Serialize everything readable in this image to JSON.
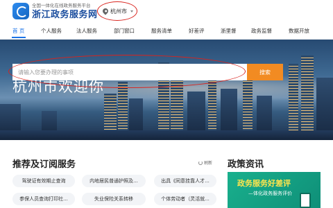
{
  "header": {
    "brand_subtitle": "全国一体化在线政务服务平台",
    "brand_title": "浙江政务服务网",
    "location": "杭州市"
  },
  "nav": {
    "items": [
      "首 页",
      "个人服务",
      "法人服务",
      "部门窗口",
      "服务清单",
      "好差评",
      "浙里督",
      "政务监督",
      "数据开放"
    ],
    "active_index": 0
  },
  "banner": {
    "title": "杭州市欢迎你",
    "search_placeholder": "请输入您要办理的事项",
    "search_button": "搜索"
  },
  "services": {
    "title": "推荐及订阅服务",
    "refresh_label": "刷新",
    "items": [
      "驾驶证有效期止查询",
      "内地居民普通护照及...",
      "出具《同意挂靠人才...",
      "参保人员查询打印社...",
      "失业保险关系转移",
      "个体劳动者（灵活就..."
    ]
  },
  "news": {
    "title": "政策资讯",
    "promo_title": "政务服务好差评",
    "promo_subtitle": "—体化政务服务评价"
  },
  "colors": {
    "accent": "#1a73e8",
    "search_button": "#f28b22",
    "highlight_ring": "#d9231d"
  }
}
